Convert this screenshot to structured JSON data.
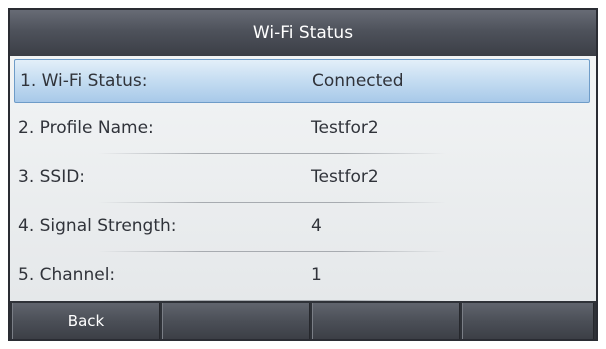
{
  "title": "Wi-Fi Status",
  "rows": [
    {
      "label": "1. Wi-Fi Status:",
      "value": "Connected"
    },
    {
      "label": "2. Profile Name:",
      "value": "Testfor2"
    },
    {
      "label": "3. SSID:",
      "value": "Testfor2"
    },
    {
      "label": "4. Signal Strength:",
      "value": "4"
    },
    {
      "label": "5. Channel:",
      "value": "1"
    }
  ],
  "softkeys": [
    "Back",
    "",
    "",
    ""
  ],
  "colors": {
    "title_bar": "#4e525b",
    "selection": "#c4dcf1",
    "softkey_bar": "#2f3238",
    "text": "#30333a"
  }
}
